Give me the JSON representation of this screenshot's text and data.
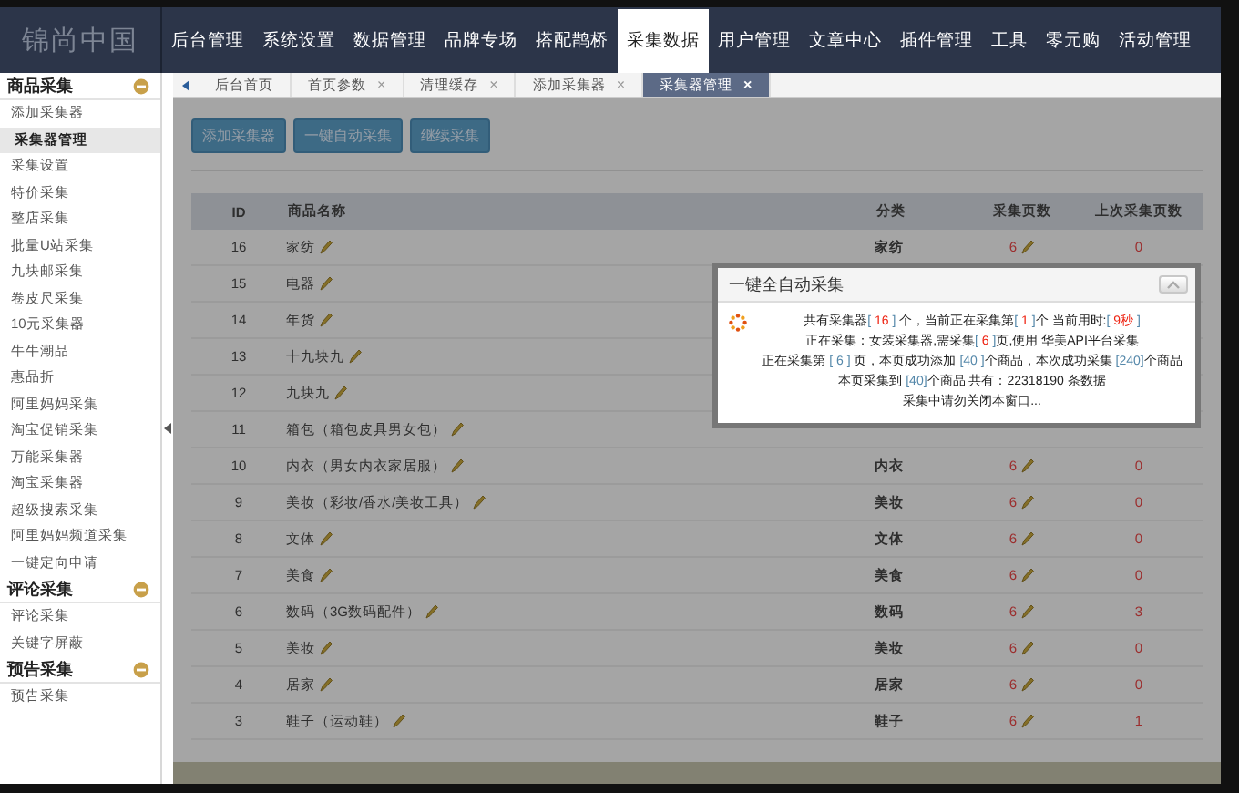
{
  "logo": "锦尚中国",
  "nav": [
    {
      "label": "后台管理",
      "selected": false
    },
    {
      "label": "系统设置",
      "selected": false
    },
    {
      "label": "数据管理",
      "selected": false
    },
    {
      "label": "品牌专场",
      "selected": false
    },
    {
      "label": "搭配鹊桥",
      "selected": false
    },
    {
      "label": "采集数据",
      "selected": true
    },
    {
      "label": "用户管理",
      "selected": false
    },
    {
      "label": "文章中心",
      "selected": false
    },
    {
      "label": "插件管理",
      "selected": false
    },
    {
      "label": "工具",
      "selected": false
    },
    {
      "label": "零元购",
      "selected": false
    },
    {
      "label": "活动管理",
      "selected": false
    }
  ],
  "sidebar": [
    {
      "title": "商品采集",
      "expanded": true,
      "items": [
        {
          "label": "添加采集器",
          "selected": false
        },
        {
          "label": "采集器管理",
          "selected": true
        },
        {
          "label": "采集设置",
          "selected": false
        },
        {
          "label": "特价采集",
          "selected": false
        },
        {
          "label": "整店采集",
          "selected": false
        },
        {
          "label": "批量U站采集",
          "selected": false
        },
        {
          "label": "九块邮采集",
          "selected": false
        },
        {
          "label": "卷皮尺采集",
          "selected": false
        },
        {
          "label": "10元采集器",
          "selected": false
        },
        {
          "label": "牛牛潮品",
          "selected": false
        },
        {
          "label": "惠品折",
          "selected": false
        },
        {
          "label": "阿里妈妈采集",
          "selected": false
        },
        {
          "label": "淘宝促销采集",
          "selected": false
        },
        {
          "label": "万能采集器",
          "selected": false
        },
        {
          "label": "淘宝采集器",
          "selected": false
        },
        {
          "label": "超级搜索采集",
          "selected": false
        },
        {
          "label": "阿里妈妈频道采集",
          "selected": false
        },
        {
          "label": "一键定向申请",
          "selected": false
        }
      ]
    },
    {
      "title": "评论采集",
      "expanded": true,
      "items": [
        {
          "label": "评论采集",
          "selected": false
        },
        {
          "label": "关键字屏蔽",
          "selected": false
        }
      ]
    },
    {
      "title": "预告采集",
      "expanded": true,
      "items": [
        {
          "label": "预告采集",
          "selected": false
        }
      ]
    }
  ],
  "tabs": [
    {
      "label": "后台首页",
      "selected": false
    },
    {
      "label": "首页参数",
      "close": "×",
      "selected": false
    },
    {
      "label": "清理缓存",
      "close": "×",
      "selected": false
    },
    {
      "label": "添加采集器",
      "close": "×",
      "selected": false
    },
    {
      "label": "采集器管理",
      "close": "×",
      "selected": true
    }
  ],
  "buttons": [
    "添加采集器",
    "一键自动采集",
    "继续采集"
  ],
  "table": {
    "columns": [
      "ID",
      "商品名称",
      "分类",
      "采集页数",
      "上次采集页数"
    ],
    "rows": [
      {
        "id": "16",
        "name": "家纺",
        "category": "家纺",
        "pages": "6",
        "last": "0"
      },
      {
        "id": "15",
        "name": "电器"
      },
      {
        "id": "14",
        "name": "年货"
      },
      {
        "id": "13",
        "name": "十九块九"
      },
      {
        "id": "12",
        "name": "九块九"
      },
      {
        "id": "11",
        "name": "箱包（箱包皮具男女包）"
      },
      {
        "id": "10",
        "name": "内衣（男女内衣家居服）",
        "category": "内衣",
        "pages": "6",
        "last": "0"
      },
      {
        "id": "9",
        "name": "美妆（彩妆/香水/美妆工具）",
        "category": "美妆",
        "pages": "6",
        "last": "0"
      },
      {
        "id": "8",
        "name": "文体",
        "category": "文体",
        "pages": "6",
        "last": "0"
      },
      {
        "id": "7",
        "name": "美食",
        "category": "美食",
        "pages": "6",
        "last": "0"
      },
      {
        "id": "6",
        "name": "数码（3G数码配件）",
        "category": "数码",
        "pages": "6",
        "last": "3"
      },
      {
        "id": "5",
        "name": "美妆",
        "category": "美妆",
        "pages": "6",
        "last": "0"
      },
      {
        "id": "4",
        "name": "居家",
        "category": "居家",
        "pages": "6",
        "last": "0"
      },
      {
        "id": "3",
        "name": "鞋子（运动鞋）",
        "category": "鞋子",
        "pages": "6",
        "last": "1"
      }
    ]
  },
  "dialog": {
    "title": "一键全自动采集",
    "lines": [
      [
        {
          "kind": "text",
          "text": "共有采集器"
        },
        {
          "kind": "blue",
          "text": "[ "
        },
        {
          "kind": "red",
          "text": "16"
        },
        {
          "kind": "blue",
          "text": " ]"
        },
        {
          "kind": "text",
          "text": " 个，当前正在采集第"
        },
        {
          "kind": "blue",
          "text": "[ "
        },
        {
          "kind": "red",
          "text": "1"
        },
        {
          "kind": "blue",
          "text": " ]"
        },
        {
          "kind": "text",
          "text": "个 当前用时:"
        },
        {
          "kind": "blue",
          "text": "[ "
        },
        {
          "kind": "red",
          "text": "9秒"
        },
        {
          "kind": "blue",
          "text": " ]"
        }
      ],
      [
        {
          "kind": "text",
          "text": "正在采集：女装采集器,需采集"
        },
        {
          "kind": "blue",
          "text": "[ "
        },
        {
          "kind": "red",
          "text": "6"
        },
        {
          "kind": "blue",
          "text": " ]"
        },
        {
          "kind": "text",
          "text": "页,使用 华美API平台采集"
        }
      ],
      [
        {
          "kind": "text",
          "text": "正在采集第 "
        },
        {
          "kind": "blue",
          "text": "[ 6 ]"
        },
        {
          "kind": "text",
          "text": " 页，本页成功添加 "
        },
        {
          "kind": "blue",
          "text": "[40 ]"
        },
        {
          "kind": "text",
          "text": "个商品，本次成功采集 "
        },
        {
          "kind": "blue",
          "text": "[240]"
        },
        {
          "kind": "text",
          "text": "个商品"
        }
      ],
      [
        {
          "kind": "text",
          "text": "本页采集到 "
        },
        {
          "kind": "blue",
          "text": "[40]"
        },
        {
          "kind": "text",
          "text": "个商品 共有：22318190 条数据"
        }
      ],
      [
        {
          "kind": "text",
          "text": "采集中请勿关闭本窗口..."
        }
      ]
    ]
  }
}
